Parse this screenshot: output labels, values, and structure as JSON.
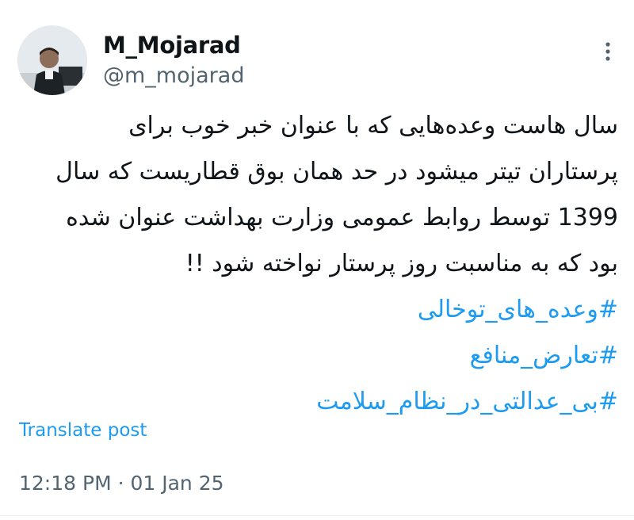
{
  "author": {
    "display_name": "M_Mojarad",
    "handle": "@m_mojarad",
    "avatar_icon": "avatar-photo"
  },
  "post": {
    "lines": [
      "سال هاست وعده‌هایی که با عنوان خبر خوب برای",
      "پرستاران تیتر میشود در حد همان بوق قطاریست که سال",
      "1399 توسط روابط عمومی وزارت بهداشت عنوان شده",
      "بود که به مناسبت روز پرستار نواخته شود !!"
    ],
    "hashtags": [
      "#وعده_های_توخالی",
      "#تعارض_منافع",
      "#بی_عدالتی_در_نظام_سلامت"
    ],
    "translate_label": "Translate post",
    "timestamp": "12:18 PM · 01 Jan 25"
  },
  "icons": {
    "more": "more-options-icon"
  },
  "colors": {
    "link": "#1d9bf0",
    "muted": "#536471",
    "text": "#0f1419"
  }
}
